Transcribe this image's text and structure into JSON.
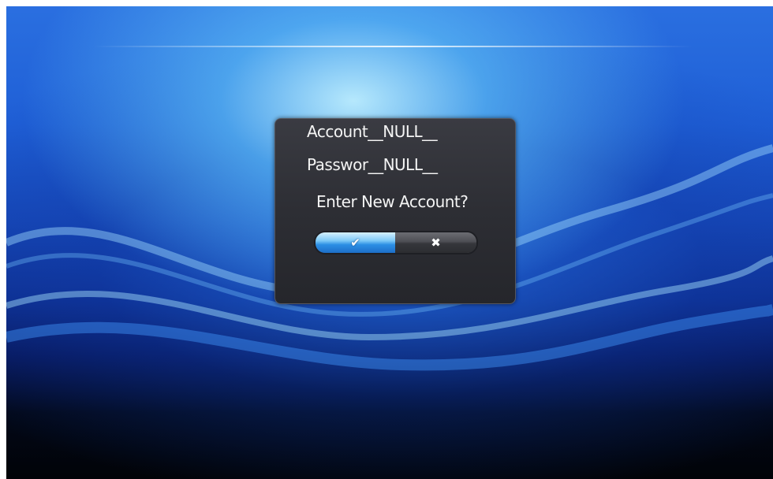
{
  "dialog": {
    "account_line": "Account__NULL__",
    "password_line": "Passwor__NULL__",
    "prompt": "Enter New Account?",
    "confirm_icon": "check-icon",
    "cancel_icon": "x-icon",
    "confirm_glyph": "✔",
    "cancel_glyph": "✖"
  },
  "colors": {
    "background_blue": "#1f5fd6",
    "dialog_background": "#2d2e34",
    "confirm_highlight": "#2c8fe4"
  }
}
